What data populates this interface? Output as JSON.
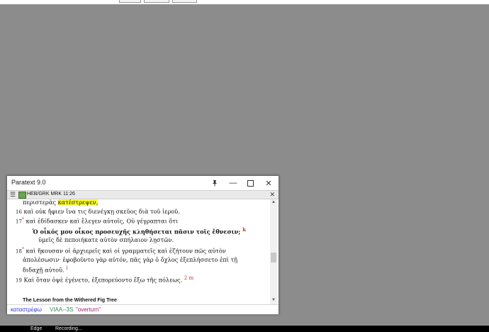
{
  "window": {
    "title": "Paratext 9.0"
  },
  "resource": {
    "reference": "HEB/GRK MRK 11:26"
  },
  "text": {
    "line1_prefix": "περιστερὰς ",
    "line1_highlight": "κατέστρεψεν,",
    "v16_num": "16",
    "v16_text": "καὶ οὐκ ἤφιεν ἵνα τις διενέγκῃ σκεῦος διὰ τοῦ ἱεροῦ.",
    "v17_num": "17",
    "v17_mark": "*",
    "v17_text": "καὶ ἐδίδασκεν καὶ ἔλεγεν αὐτοῖς, Οὐ γέγραπται ὅτι",
    "quote_text": "Ὁ οἶκός μου οἶκος προσευχῆς κληθήσεται πᾶσιν τοῖς ἔθνεσιν;",
    "quote_fn": "k",
    "quote2_text": "ὑμεῖς δὲ πεποιήκατε αὐτὸν σπήλαιον λῃστῶν.",
    "v18_num": "18",
    "v18_mark": "*",
    "v18_text": "καὶ ἤκουσαν οἱ ἀρχιερεῖς καὶ οἱ γραμματεῖς καὶ ἐζήτουν πῶς αὐτὸν",
    "v18_line2": "ἀπολέσωσιν· ἐφοβοῦντο γὰρ αὐτόν, πᾶς γὰρ ὁ ὄχλος ἐξεπλήσσετο ἐπὶ τῇ",
    "v18_line3": "διδαχῇ αὐτοῦ.",
    "v18_fn": "l",
    "v19_num": "19",
    "v19_text": "Καὶ ὅταν ὀψὲ ἐγένετο, ἐξεπορεύοντο ἔξω τῆς πόλεως.",
    "v19_fn": "2 m",
    "heading": "The Lesson from the Withered Fig Tree"
  },
  "status": {
    "lemma": "καταστρέφω",
    "parse": "VIAA--3S",
    "gloss": "\"overturn\""
  },
  "taskbar": {
    "item1": "Edge",
    "item2": "Recording..."
  },
  "colors": {
    "highlight": "#ffff33",
    "footnote": "#c0392b",
    "lemma": "#3333cc",
    "parse": "#2e8b57",
    "gloss": "#a0206a"
  }
}
